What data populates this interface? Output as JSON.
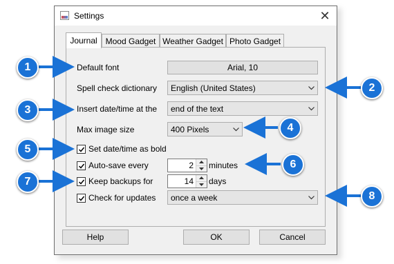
{
  "window": {
    "title": "Settings",
    "close_glyph": "✕"
  },
  "tabs": [
    {
      "label": "Journal",
      "active": true
    },
    {
      "label": "Mood Gadget",
      "active": false
    },
    {
      "label": "Weather Gadget",
      "active": false
    },
    {
      "label": "Photo Gadget",
      "active": false
    }
  ],
  "journal": {
    "default_font": {
      "label": "Default font",
      "value": "Arial, 10"
    },
    "spell_check": {
      "label": "Spell check dictionary",
      "value": "English (United States)"
    },
    "insert_datetime": {
      "label": "Insert date/time at the",
      "value": "end of the text"
    },
    "max_image_size": {
      "label": "Max image size",
      "value": "400 Pixels"
    },
    "bold_datetime": {
      "label": "Set date/time as bold",
      "checked": true
    },
    "autosave": {
      "label": "Auto-save every",
      "checked": true,
      "value": "2",
      "unit": "minutes"
    },
    "backups": {
      "label": "Keep backups for",
      "checked": true,
      "value": "14",
      "unit": "days"
    },
    "updates": {
      "label": "Check for updates",
      "checked": true,
      "value": "once a week"
    }
  },
  "buttons": {
    "help": "Help",
    "ok": "OK",
    "cancel": "Cancel"
  },
  "callouts": [
    "1",
    "2",
    "3",
    "4",
    "5",
    "6",
    "7",
    "8"
  ],
  "colors": {
    "callout": "#1a72d6",
    "window_bg": "#f0f0f0"
  }
}
